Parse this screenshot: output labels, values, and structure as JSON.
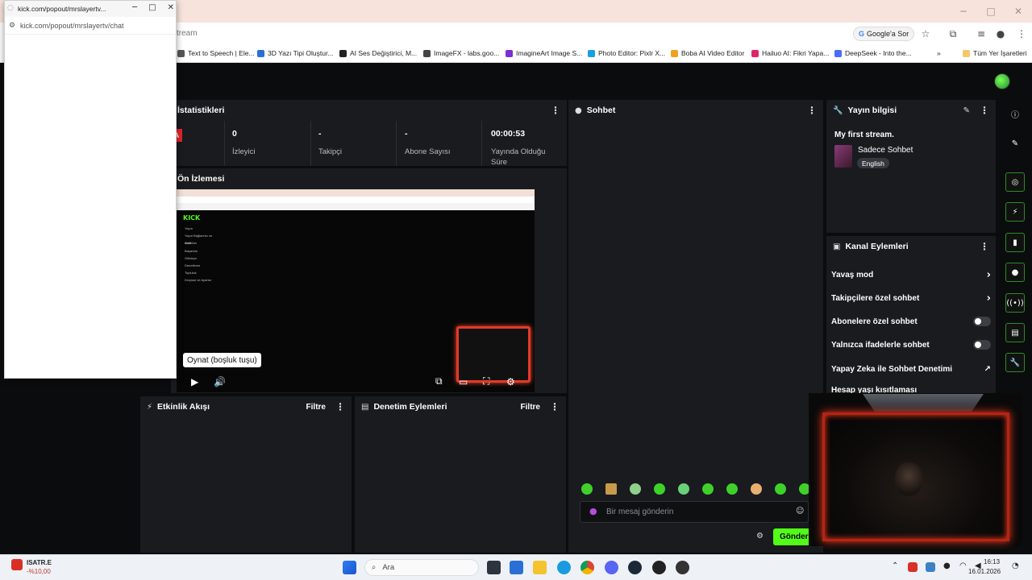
{
  "browser": {
    "address_partial": "stream",
    "google_sor": "Google'a Sor",
    "bookmarks": [
      "Text to Speech | Ele...",
      "3D Yazı Tipi Oluştur...",
      "AI Ses Değiştirici, M...",
      "ImageFX - labs.goo...",
      "ImagineArt Image S...",
      "Photo Editor: Pixlr X...",
      "Boba AI Video Editor",
      "Hailuo AI: Fikri Yapa...",
      "DeepSeek - Into the...",
      "Tüm Yer İşaretleri"
    ]
  },
  "popout": {
    "title": "kick.com/popout/mrslayertv...",
    "url": "kick.com/popout/mrslayertv/chat"
  },
  "stats": {
    "title": "İstatistikleri",
    "badge": "A",
    "items": [
      {
        "value": "0",
        "label": "İzleyici"
      },
      {
        "value": "-",
        "label": "Takipçi"
      },
      {
        "value": "-",
        "label": "Abone Sayısı"
      },
      {
        "value": "00:00:53",
        "label": "Yayında Olduğu Süre"
      }
    ]
  },
  "preview": {
    "title": "Ön İzlemesi",
    "kick_logo": "KICK",
    "menu": [
      "Yayın",
      "Yayın Bağlantısı ve Anahtarı",
      "Gelir",
      "Başarılar",
      "Oldukça",
      "Denetleme",
      "Topluluk",
      "Dropsar ve Ayarlar"
    ],
    "tooltip": "Oynat (boşluk tuşu)"
  },
  "activity": {
    "title": "Etkinlik Akışı",
    "filter": "Filtre"
  },
  "moderation": {
    "title": "Denetim Eylemleri",
    "filter": "Filtre"
  },
  "chat": {
    "title": "Sohbet",
    "placeholder": "Bir mesaj gönderin",
    "send": "Gönder"
  },
  "stream_info": {
    "title": "Yayın bilgisi",
    "stream_title": "My first stream.",
    "category": "Sadece Sohbet",
    "language": "English"
  },
  "channel_actions": {
    "title": "Kanal Eylemleri",
    "rows": [
      {
        "label": "Yavaş mod",
        "control": "chevron"
      },
      {
        "label": "Takipçilere özel sohbet",
        "control": "chevron"
      },
      {
        "label": "Abonelere özel sohbet",
        "control": "toggle",
        "on": false
      },
      {
        "label": "Yalnızca ifadelerle sohbet",
        "control": "toggle",
        "on": false
      },
      {
        "label": "Yapay Zeka ile Sohbet Denetimi",
        "control": "external"
      },
      {
        "label": "Hesap yaşı kısıtlaması",
        "control": "chevron"
      }
    ]
  },
  "taskbar": {
    "stock_name": "ISATR.E",
    "stock_change": "-%10,00",
    "search": "Ara",
    "time": "16:13",
    "date": "16.01.2026"
  },
  "colors": {
    "accent": "#53fc18",
    "panel": "#191b1f",
    "bg": "#0b0c0d",
    "live": "#e0242c"
  }
}
